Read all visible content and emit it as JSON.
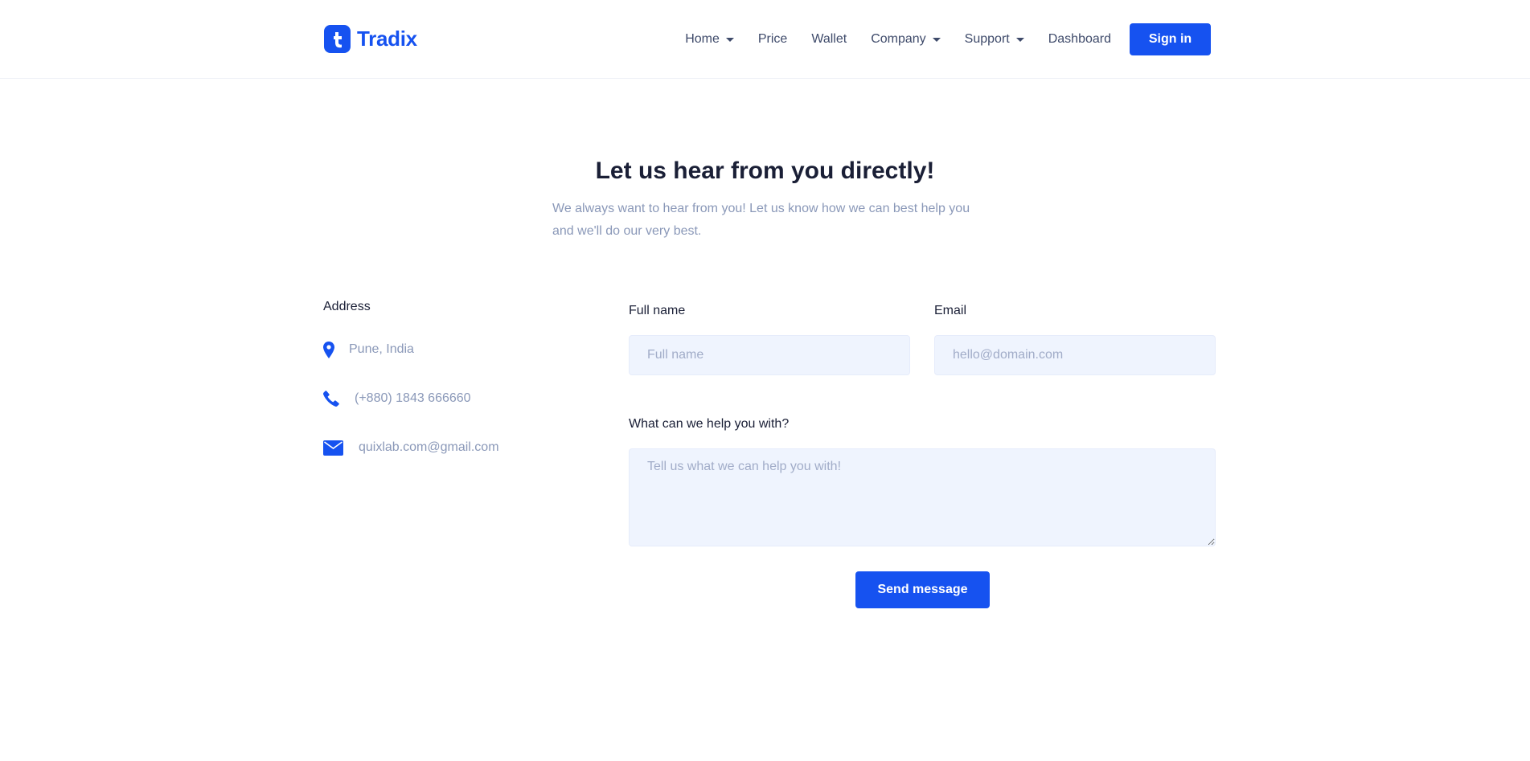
{
  "brand": {
    "name": "Tradix",
    "accent": "#1652f0"
  },
  "nav": {
    "items": [
      {
        "label": "Home",
        "dropdown": true
      },
      {
        "label": "Price",
        "dropdown": false
      },
      {
        "label": "Wallet",
        "dropdown": false
      },
      {
        "label": "Company",
        "dropdown": true
      },
      {
        "label": "Support",
        "dropdown": true
      },
      {
        "label": "Dashboard",
        "dropdown": false
      }
    ],
    "signin_label": "Sign in"
  },
  "hero": {
    "title": "Let us hear from you directly!",
    "subtitle": "We always want to hear from you! Let us know how we can best help you and we'll do our very best."
  },
  "contact": {
    "heading": "Address",
    "address": {
      "icon": "map-pin-icon",
      "text": "Pune, India"
    },
    "phone": {
      "icon": "phone-icon",
      "text": "(+880) 1843 666660"
    },
    "email": {
      "icon": "envelope-icon",
      "text": "quixlab.com@gmail.com"
    }
  },
  "form": {
    "name_label": "Full name",
    "name_placeholder": "Full name",
    "email_label": "Email",
    "email_placeholder": "hello@domain.com",
    "message_label": "What can we help you with?",
    "message_placeholder": "Tell us what we can help you with!",
    "submit_label": "Send message"
  }
}
